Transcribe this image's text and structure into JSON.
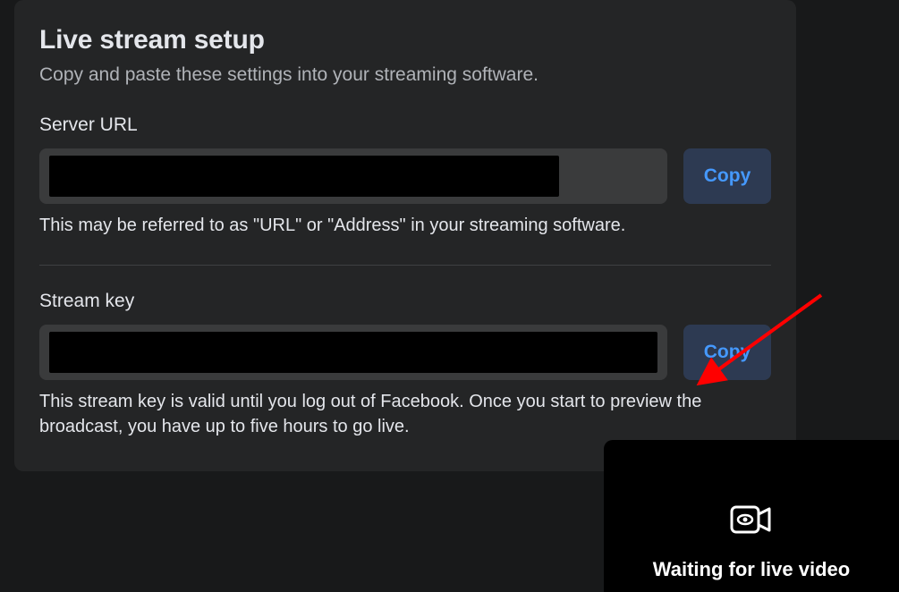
{
  "panel": {
    "title": "Live stream setup",
    "subtitle": "Copy and paste these settings into your streaming software."
  },
  "server_url": {
    "label": "Server URL",
    "value": "",
    "copy_label": "Copy",
    "help": "This may be referred to as \"URL\" or \"Address\" in your streaming software."
  },
  "stream_key": {
    "label": "Stream key",
    "value": "",
    "copy_label": "Copy",
    "help": "This stream key is valid until you log out of Facebook. Once you start to preview the broadcast, you have up to five hours to go live."
  },
  "waiting": {
    "text": "Waiting for live video"
  }
}
